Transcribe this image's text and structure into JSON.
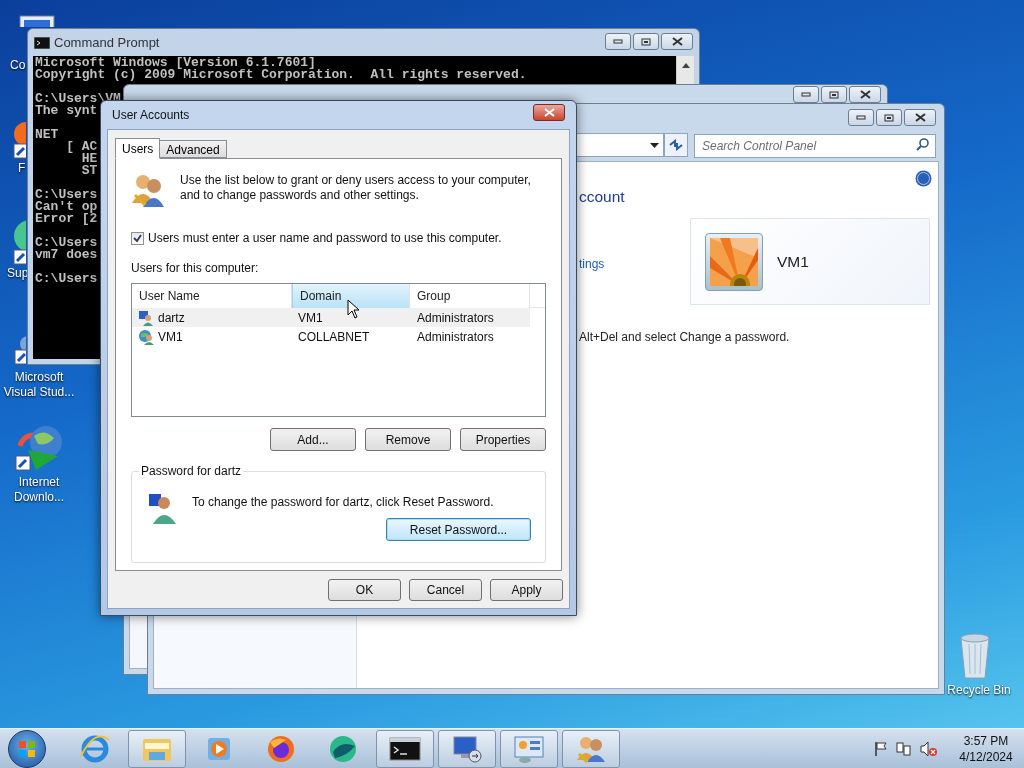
{
  "desktop_icons": [
    {
      "label": "Co"
    },
    {
      "label": "F"
    },
    {
      "label": "Sup"
    },
    {
      "label": "Microsoft Visual Stud..."
    },
    {
      "label": "Internet Downlo..."
    },
    {
      "label": "Recycle Bin"
    }
  ],
  "command_prompt": {
    "title": "Command Prompt",
    "blocks": [
      [
        "Microsoft Windows [Version 6.1.7601]",
        "Copyright (c) 2009 Microsoft Corporation.  All rights reserved."
      ],
      [
        "C:\\Users\\VM",
        "The synt"
      ],
      [
        "NET",
        "    [ AC",
        "      HE",
        "      ST"
      ],
      [
        "C:\\Users",
        "Can't op",
        "Error [2"
      ],
      [
        "C:\\Users",
        "vm7 does"
      ],
      [
        "C:\\Users"
      ]
    ]
  },
  "control_panel": {
    "search": {
      "placeholder": "Search Control Panel"
    },
    "heading": "ccount",
    "link": "tings",
    "account_name": "VM1",
    "note": "Alt+Del and select Change a password."
  },
  "dialog": {
    "title": "User Accounts",
    "tabs": [
      {
        "label": "Users",
        "selected": true
      },
      {
        "label": "Advanced",
        "selected": false
      }
    ],
    "intro": "Use the list below to grant or deny users access to your computer, and to change passwords and other settings.",
    "require_login": {
      "label": "Users must enter a user name and password to use this computer.",
      "checked": true
    },
    "list_label": "Users for this computer:",
    "columns": [
      {
        "label": "User Name",
        "highlighted": false
      },
      {
        "label": "Domain",
        "highlighted": true
      },
      {
        "label": "Group",
        "highlighted": false
      }
    ],
    "rows": [
      {
        "user_name": "dartz",
        "domain": "VM1",
        "group": "Administrators",
        "selected": true
      },
      {
        "user_name": "VM1",
        "domain": "COLLABNET",
        "group": "Administrators",
        "selected": false
      }
    ],
    "list_buttons": [
      "Add...",
      "Remove",
      "Properties"
    ],
    "password_group": {
      "title": "Password for dartz",
      "text": "To change the password for dartz, click Reset Password.",
      "button": "Reset Password..."
    },
    "footer_buttons": [
      "OK",
      "Cancel",
      "Apply"
    ]
  },
  "taskbar": {
    "apps": [
      {
        "running": false
      },
      {
        "running": true
      },
      {
        "running": false
      },
      {
        "running": false
      },
      {
        "running": false
      },
      {
        "running": true
      },
      {
        "running": true
      },
      {
        "running": true
      },
      {
        "running": true
      }
    ],
    "clock": {
      "time": "3:57 PM",
      "date": "4/12/2024"
    }
  }
}
